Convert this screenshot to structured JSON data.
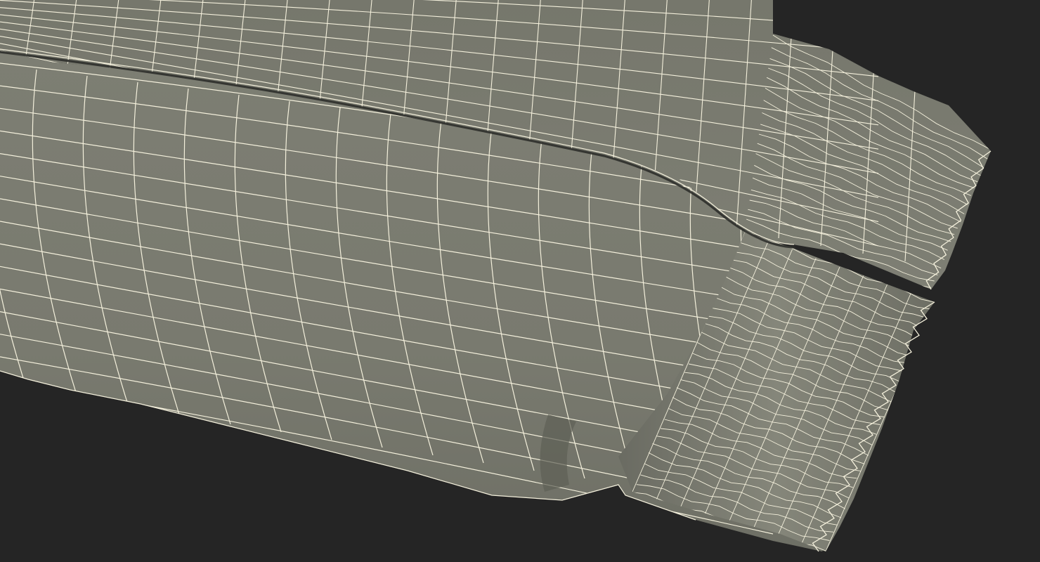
{
  "scene": {
    "subject": "candy-bar-wrapper-wireframe",
    "colors": {
      "background": "#252525",
      "surface": "#7a7b70",
      "surface_light": "#87887c",
      "surface_dark": "#5e5f56",
      "crease": "#2e2f2b",
      "wire": "#f4f0dc"
    }
  }
}
